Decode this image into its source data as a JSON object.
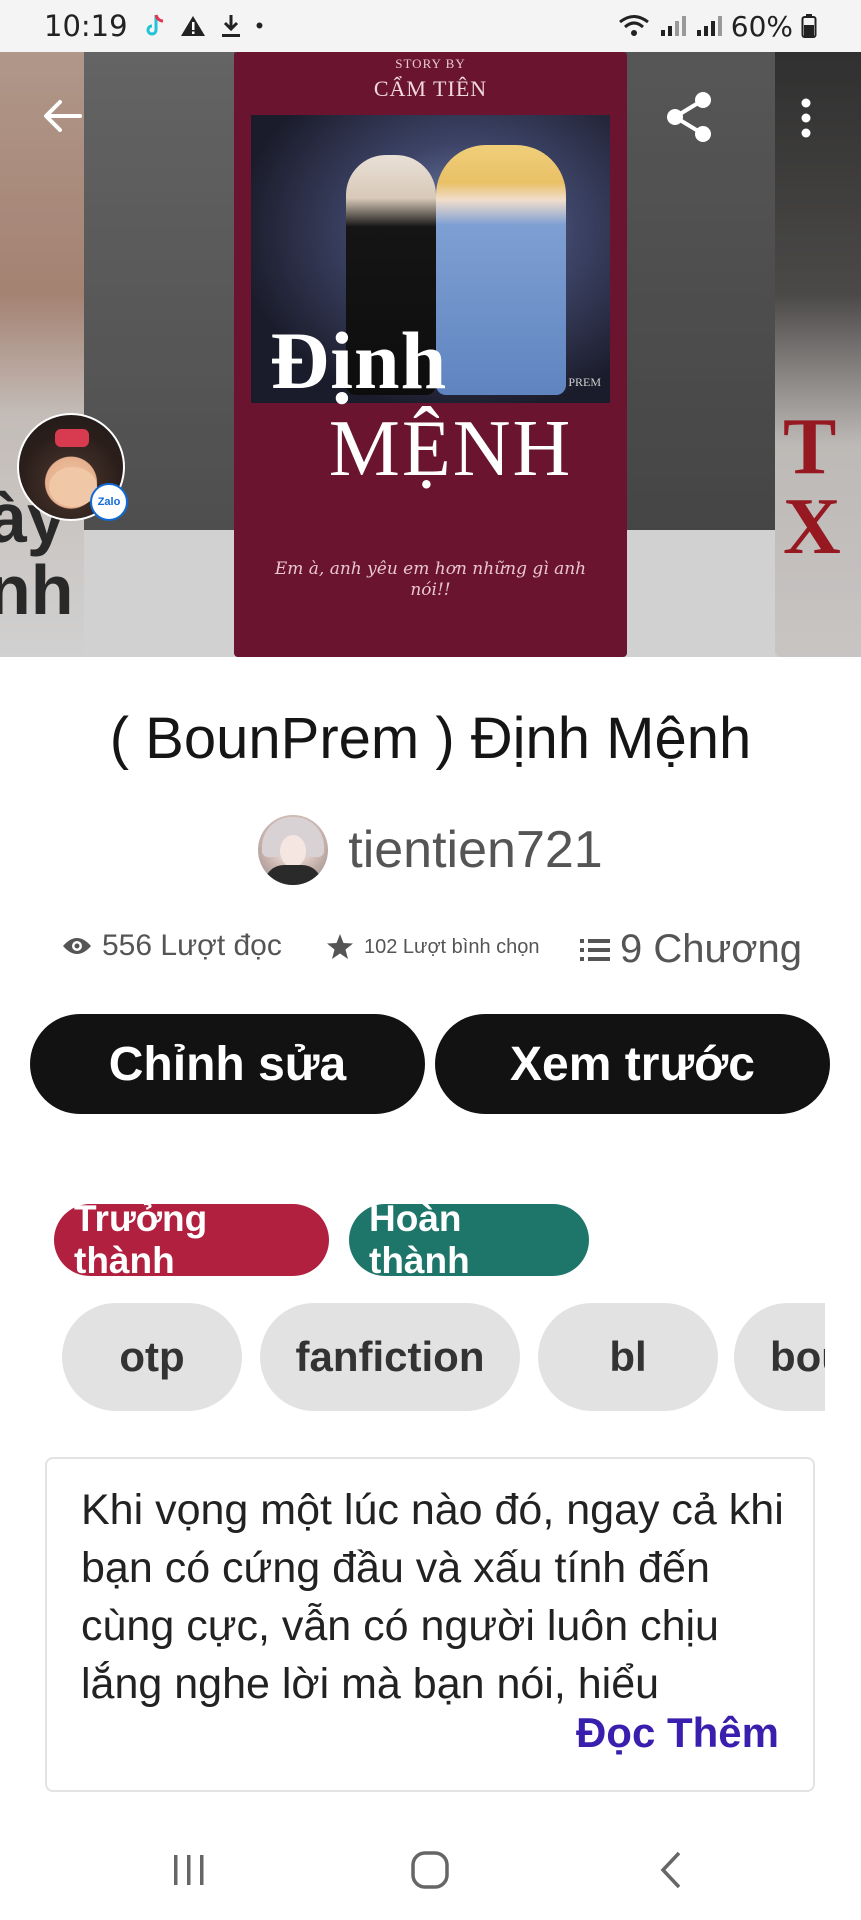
{
  "status_bar": {
    "time": "10:19",
    "battery_percent": "60%",
    "dot": "•",
    "icons": [
      "tiktok-icon",
      "warning-icon",
      "download-icon",
      "wifi-icon",
      "signal-icon",
      "signal-icon",
      "battery-icon"
    ]
  },
  "hero": {
    "cover": {
      "story_by": "STORY BY",
      "author": "CẨM TIÊN",
      "title_line1": "Định",
      "title_line2": "MỆNH",
      "mark": "PREM",
      "tagline": "Em à, anh yêu em hơn những gì anh nói!!"
    },
    "left_cover_letters": "ày\nnh",
    "right_cover_letters": "T\nX",
    "zalo_label": "Zalo",
    "icons": {
      "back": "arrow-left-icon",
      "share": "share-icon",
      "more": "more-vertical-icon"
    }
  },
  "story": {
    "title": "( BounPrem ) Định Mệnh",
    "author": "tientien721"
  },
  "stats": {
    "reads": "556 Lượt đọc",
    "votes": "102 Lượt bình chọn",
    "chapters": "9 Chương"
  },
  "actions": {
    "edit": "Chỉnh sửa",
    "preview": "Xem trước"
  },
  "badges": {
    "mature": "Trưởng thành",
    "complete": "Hoàn thành"
  },
  "tags": [
    "otp",
    "fanfiction",
    "bl",
    "bou"
  ],
  "description": {
    "text": "Khi vọng một lúc nào đó, ngay cả khi bạn có cứng đầu và xấu tính đến cùng cực, vẫn có người luôn chịu lắng nghe lời mà bạn nói, hiểu",
    "read_more": "Đọc Thêm"
  },
  "colors": {
    "mature_badge": "#b2203f",
    "complete_badge": "#1e7569",
    "button_bg": "#121212",
    "read_more": "#3a1fae",
    "cover_bg": "#6a1430"
  }
}
